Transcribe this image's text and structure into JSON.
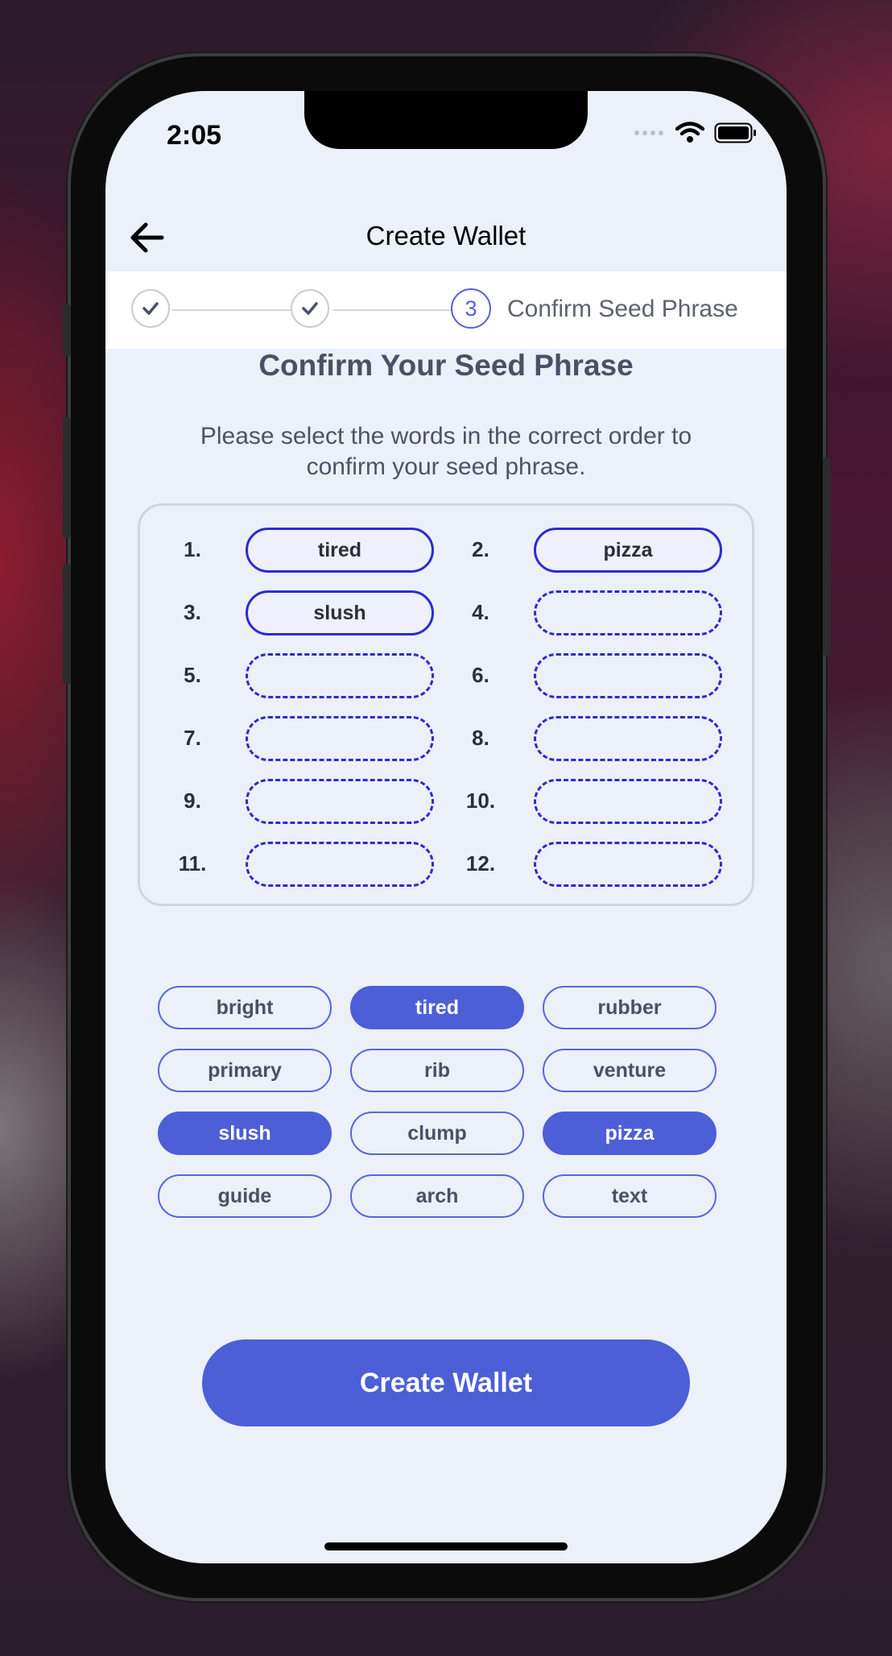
{
  "status_bar": {
    "time": "2:05"
  },
  "header": {
    "title": "Create Wallet"
  },
  "stepper": {
    "current_step_number": "3",
    "current_step_label": "Confirm Seed Phrase"
  },
  "content": {
    "title": "Confirm Your Seed Phrase",
    "instruction_line1": "Please select the words in the correct order to",
    "instruction_line2": "confirm your seed phrase."
  },
  "phrase_slots": [
    {
      "number": "1.",
      "word": "tired"
    },
    {
      "number": "2.",
      "word": "pizza"
    },
    {
      "number": "3.",
      "word": "slush"
    },
    {
      "number": "4.",
      "word": ""
    },
    {
      "number": "5.",
      "word": ""
    },
    {
      "number": "6.",
      "word": ""
    },
    {
      "number": "7.",
      "word": ""
    },
    {
      "number": "8.",
      "word": ""
    },
    {
      "number": "9.",
      "word": ""
    },
    {
      "number": "10.",
      "word": ""
    },
    {
      "number": "11.",
      "word": ""
    },
    {
      "number": "12.",
      "word": ""
    }
  ],
  "word_choices": [
    {
      "word": "bright",
      "selected": false
    },
    {
      "word": "tired",
      "selected": true
    },
    {
      "word": "rubber",
      "selected": false
    },
    {
      "word": "primary",
      "selected": false
    },
    {
      "word": "rib",
      "selected": false
    },
    {
      "word": "venture",
      "selected": false
    },
    {
      "word": "slush",
      "selected": true
    },
    {
      "word": "clump",
      "selected": false
    },
    {
      "word": "pizza",
      "selected": true
    },
    {
      "word": "guide",
      "selected": false
    },
    {
      "word": "arch",
      "selected": false
    },
    {
      "word": "text",
      "selected": false
    }
  ],
  "actions": {
    "create_wallet_label": "Create Wallet"
  },
  "colors": {
    "accent": "#4c5fd7",
    "slot_border": "#2b2bd0",
    "background": "#ecf0f8",
    "step_accent": "#5a5fd6"
  }
}
